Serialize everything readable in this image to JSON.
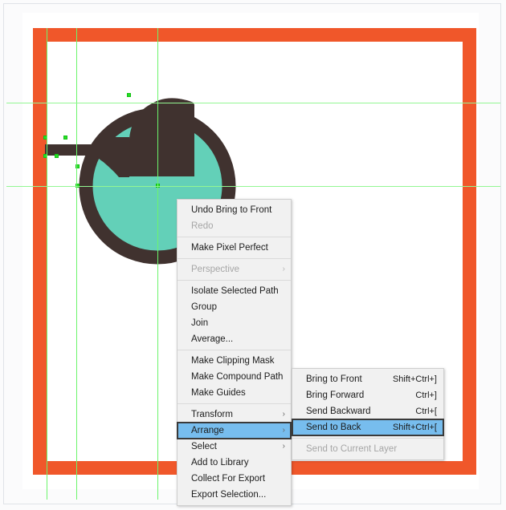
{
  "app": {
    "artwork_colors": {
      "orange_frame": "#f0572a",
      "teapot_body": "#40322f",
      "teapot_fill": "#63d0b8",
      "canvas": "#ffffff",
      "guide": "#6cf56c",
      "anchor": "#25e025"
    },
    "artwork_name": "teapot-illustration"
  },
  "context_menu": {
    "name": "canvas-context-menu",
    "items": [
      {
        "label": "Undo Bring to Front",
        "accel": "",
        "state": "enabled",
        "submenu": false
      },
      {
        "label": "Redo",
        "accel": "",
        "state": "disabled",
        "submenu": false
      },
      {
        "separator": true
      },
      {
        "label": "Make Pixel Perfect",
        "accel": "",
        "state": "enabled",
        "submenu": false
      },
      {
        "separator": true
      },
      {
        "label": "Perspective",
        "accel": "",
        "state": "disabled",
        "submenu": true
      },
      {
        "separator": true
      },
      {
        "label": "Isolate Selected Path",
        "accel": "",
        "state": "enabled",
        "submenu": false
      },
      {
        "label": "Group",
        "accel": "",
        "state": "enabled",
        "submenu": false
      },
      {
        "label": "Join",
        "accel": "",
        "state": "enabled",
        "submenu": false
      },
      {
        "label": "Average...",
        "accel": "",
        "state": "enabled",
        "submenu": false
      },
      {
        "separator": true
      },
      {
        "label": "Make Clipping Mask",
        "accel": "",
        "state": "enabled",
        "submenu": false
      },
      {
        "label": "Make Compound Path",
        "accel": "",
        "state": "enabled",
        "submenu": false
      },
      {
        "label": "Make Guides",
        "accel": "",
        "state": "enabled",
        "submenu": false
      },
      {
        "separator": true
      },
      {
        "label": "Transform",
        "accel": "",
        "state": "enabled",
        "submenu": true
      },
      {
        "label": "Arrange",
        "accel": "",
        "state": "selected",
        "submenu": true
      },
      {
        "label": "Select",
        "accel": "",
        "state": "enabled",
        "submenu": true
      },
      {
        "label": "Add to Library",
        "accel": "",
        "state": "enabled",
        "submenu": false
      },
      {
        "label": "Collect For Export",
        "accel": "",
        "state": "enabled",
        "submenu": false
      },
      {
        "label": "Export Selection...",
        "accel": "",
        "state": "enabled",
        "submenu": false
      }
    ]
  },
  "arrange_submenu": {
    "name": "arrange-submenu",
    "items": [
      {
        "label": "Bring to Front",
        "accel": "Shift+Ctrl+]",
        "state": "enabled"
      },
      {
        "label": "Bring Forward",
        "accel": "Ctrl+]",
        "state": "enabled"
      },
      {
        "label": "Send Backward",
        "accel": "Ctrl+[",
        "state": "enabled"
      },
      {
        "label": "Send to Back",
        "accel": "Shift+Ctrl+[",
        "state": "selected"
      },
      {
        "separator": true
      },
      {
        "label": "Send to Current Layer",
        "accel": "",
        "state": "disabled"
      }
    ]
  },
  "guides": {
    "vertical_x": [
      58,
      95,
      196
    ],
    "horizontal_y": [
      128,
      232
    ]
  },
  "arrow_glyph": "›"
}
